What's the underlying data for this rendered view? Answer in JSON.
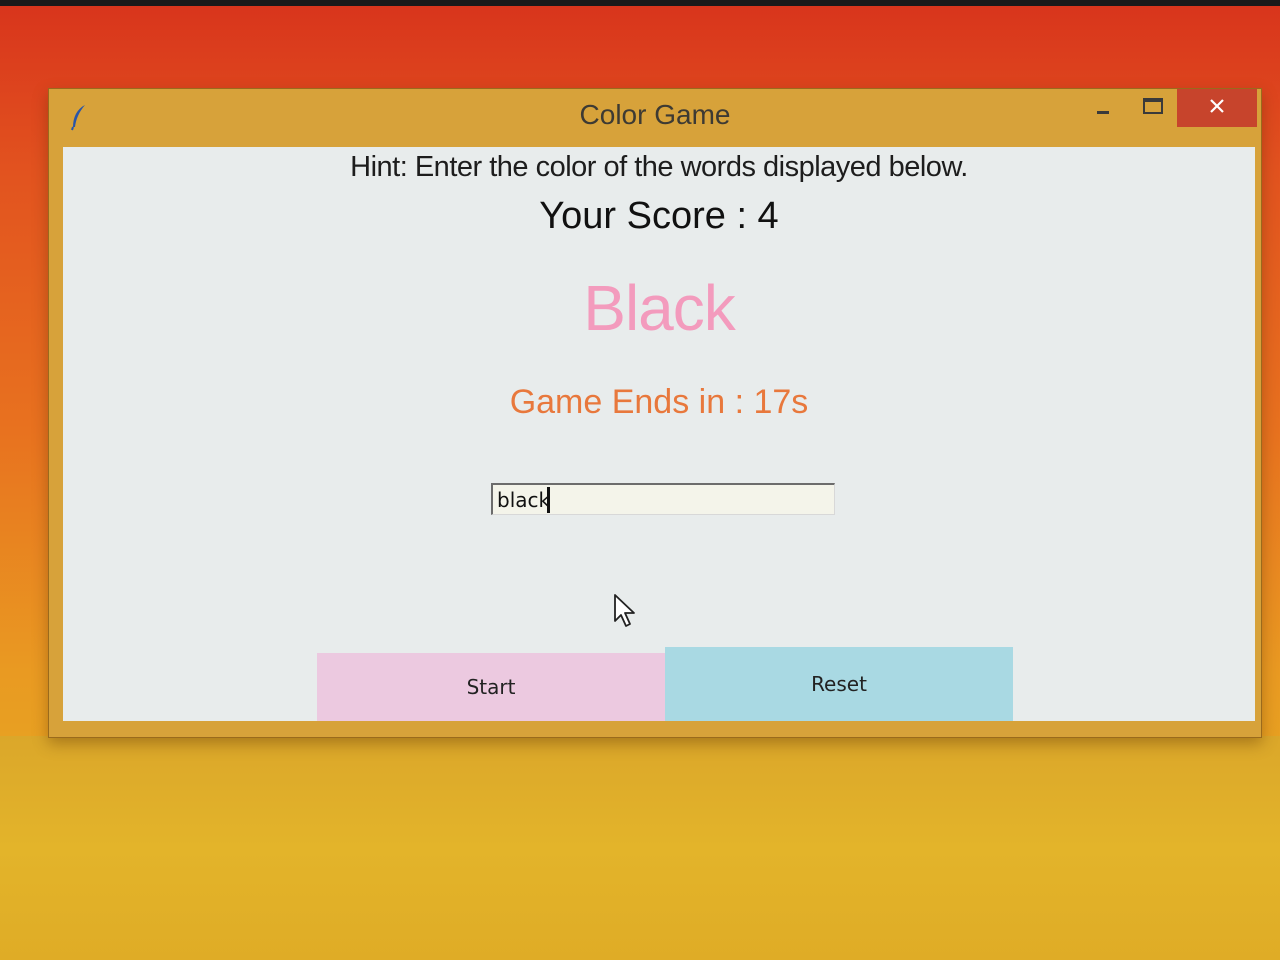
{
  "window": {
    "title": "Color Game",
    "close_glyph": "✕"
  },
  "game": {
    "hint": "Hint: Enter the color of the words displayed below.",
    "score": "Your Score : 4",
    "word": "Black",
    "word_color": "#f39bbd",
    "timer": "Game Ends in : 17s",
    "timer_color": "#e8783c"
  },
  "entry": {
    "value": "black"
  },
  "buttons": {
    "start_label": "Start",
    "start_color": "#ecc9e0",
    "reset_label": "Reset",
    "reset_color": "#a9d9e3"
  },
  "icons": {
    "app": "feather-icon",
    "minimize": "minimize-icon",
    "maximize": "maximize-icon",
    "close": "close-icon",
    "cursor": "mouse-pointer-icon"
  }
}
